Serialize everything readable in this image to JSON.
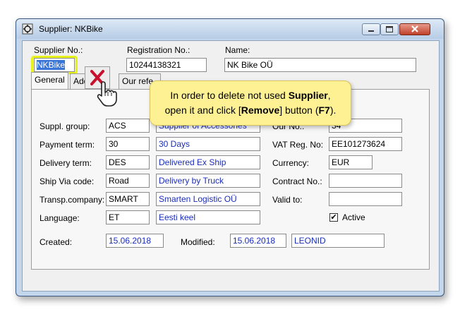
{
  "window": {
    "title": "Supplier: NKBike"
  },
  "header": {
    "supplier_no_label": "Supplier No.:",
    "supplier_no_value": "NKBike",
    "registration_label": "Registration No.:",
    "registration_value": "10244138321",
    "name_label": "Name:",
    "name_value": "NK Bike OÜ"
  },
  "tabs": [
    {
      "label": "General"
    },
    {
      "label": "Addre"
    },
    {
      "label": "Our refe"
    }
  ],
  "general": {
    "suppl_group_label": "Suppl. group:",
    "suppl_group_code": "ACS",
    "suppl_group_desc": "Supplier of Accessories",
    "payment_term_label": "Payment term:",
    "payment_term_code": "30",
    "payment_term_desc": "30 Days",
    "delivery_term_label": "Delivery term:",
    "delivery_term_code": "DES",
    "delivery_term_desc": "Delivered Ex Ship",
    "ship_via_label": "Ship Via code:",
    "ship_via_code": "Road",
    "ship_via_desc": "Delivery by Truck",
    "transp_label": "Transp.company:",
    "transp_code": "SMART",
    "transp_desc": "Smarten Logistic OÜ",
    "language_label": "Language:",
    "language_code": "ET",
    "language_desc": "Eesti keel",
    "our_no_label": "Our No.:",
    "our_no_value": "34",
    "vat_label": "VAT Reg. No:",
    "vat_value": "EE101273624",
    "currency_label": "Currency:",
    "currency_value": "EUR",
    "contract_label": "Contract No.:",
    "contract_value": "",
    "valid_to_label": "Valid to:",
    "valid_to_value": "",
    "active_label": "Active",
    "active_checked": "✔",
    "created_label": "Created:",
    "created_value": "15.06.2018",
    "modified_label": "Modified:",
    "modified_value": "15.06.2018",
    "modified_by": "LEONID"
  },
  "tooltip": {
    "line1_prefix": "In order to delete not used ",
    "line1_bold": "Supplier",
    "line1_suffix": ",",
    "line2_prefix": "open it and click [",
    "line2_bold": "Remove",
    "line2_mid": "] button (",
    "line2_key": "F7",
    "line2_suffix": ")."
  },
  "icons": {
    "app": "supplier-app-icon",
    "remove": "remove-x-icon",
    "cursor": "hand-pointer-icon"
  },
  "colors": {
    "window_frame": "#c3d6ec",
    "tooltip_bg": "#fdf193",
    "highlight": "#e6f21a",
    "remove_red": "#c8102e",
    "blue_text": "#1a2dbb"
  }
}
